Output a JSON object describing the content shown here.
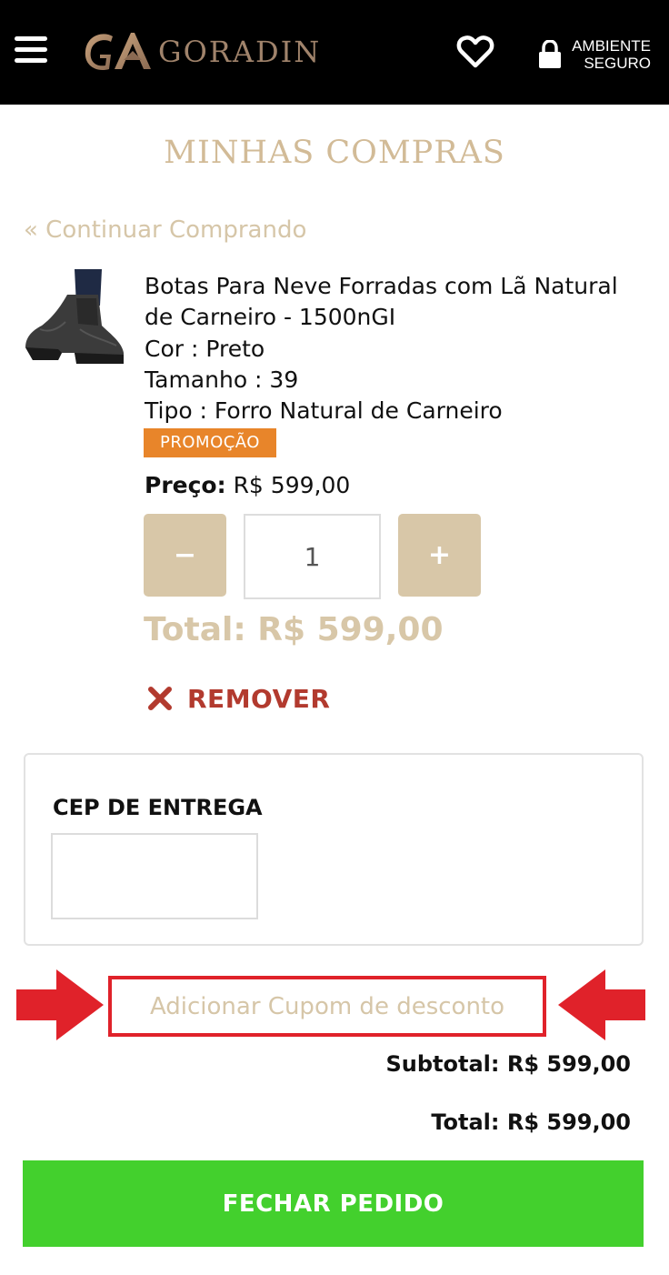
{
  "header": {
    "brand_name": "GORADIN",
    "brand_mark": "GA",
    "secure_line1": "AMBIENTE",
    "secure_line2": "SEGURO"
  },
  "page": {
    "title": "MINHAS COMPRAS",
    "continue_link": "« Continuar Comprando"
  },
  "product": {
    "name": "Botas Para Neve Forradas com Lã Natural de Carneiro - 1500nGI",
    "color": "Cor : Preto",
    "size": "Tamanho : 39",
    "type": "Tipo : Forro Natural de Carneiro",
    "badge": "PROMOÇÃO",
    "price_label": "Preço:",
    "price_value": "R$ 599,00",
    "qty_minus": "−",
    "qty_value": "1",
    "qty_plus": "+",
    "total": "Total: R$ 599,00",
    "remove_label": "REMOVER"
  },
  "shipping": {
    "cep_label": "CEP DE ENTREGA",
    "cep_value": ""
  },
  "coupon": {
    "label": "Adicionar Cupom de desconto"
  },
  "summary": {
    "subtotal": "Subtotal: R$ 599,00",
    "total": "Total: R$ 599,00"
  },
  "checkout": {
    "label": "FECHAR PEDIDO"
  },
  "colors": {
    "header_bg": "#000000",
    "gold": "#d2bb97",
    "promo": "#e8852a",
    "remove": "#b23a2e",
    "checkout": "#43d02d",
    "highlight": "#e0222a"
  },
  "icons": [
    "menu-icon",
    "logo-mark",
    "heart-icon",
    "lock-icon",
    "close-x-icon",
    "arrow-right-icon",
    "arrow-left-icon"
  ]
}
